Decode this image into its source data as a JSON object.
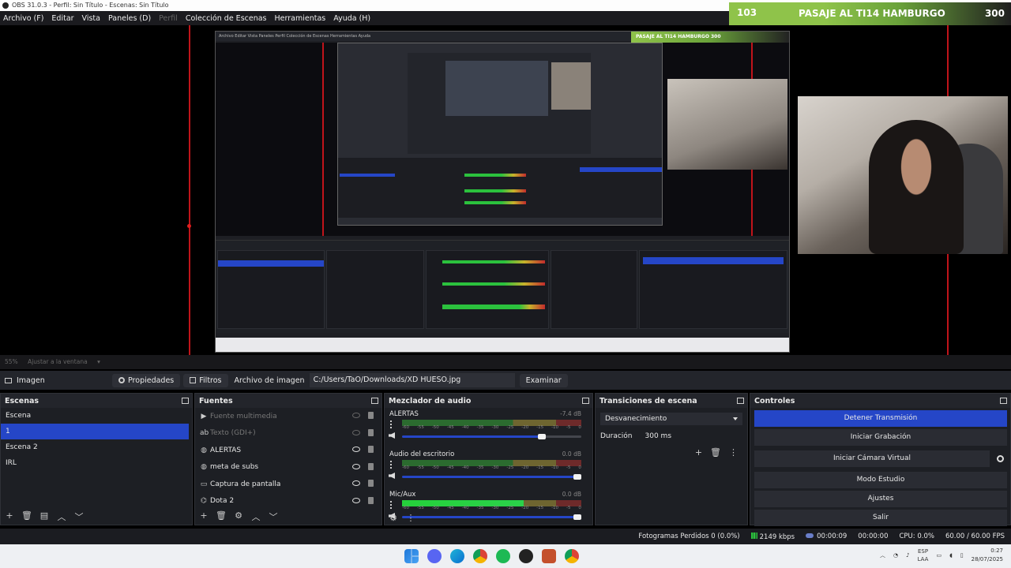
{
  "window": {
    "title": "OBS 31.0.3 - Perfil: Sin Título - Escenas: Sin Título"
  },
  "menu": [
    {
      "label": "Archivo (F)",
      "disabled": false
    },
    {
      "label": "Editar",
      "disabled": false
    },
    {
      "label": "Vista",
      "disabled": false
    },
    {
      "label": "Paneles (D)",
      "disabled": false
    },
    {
      "label": "Perfil",
      "disabled": true
    },
    {
      "label": "Colección de Escenas",
      "disabled": false
    },
    {
      "label": "Herramientas",
      "disabled": false
    },
    {
      "label": "Ayuda (H)",
      "disabled": false
    }
  ],
  "banner": {
    "left_number": "103",
    "text": "PASAJE AL TI14 HAMBURGO",
    "right_number": "300",
    "color": "#8fc34a"
  },
  "nested": {
    "menubar": "Archivo  Editar  Vista  Paneles  Perfil  Colección de Escenas  Herramientas  Ayuda",
    "banner": "PASAJE AL TI14 HAMBURGO  300"
  },
  "zoom": {
    "percent": "55%",
    "fit_label": "Ajustar a la ventana"
  },
  "context_bar": {
    "source_name": "Imagen",
    "properties_label": "Propiedades",
    "filters_label": "Filtros",
    "image_file_label": "Archivo de imagen",
    "image_path": "C:/Users/TaO/Downloads/XD HUESO.jpg",
    "browse_label": "Examinar"
  },
  "scenes": {
    "title": "Escenas",
    "items": [
      {
        "label": "Escena",
        "selected": false
      },
      {
        "label": "1",
        "selected": true
      },
      {
        "label": "Escena 2",
        "selected": false
      },
      {
        "label": "IRL",
        "selected": false
      }
    ]
  },
  "sources": {
    "title": "Fuentes",
    "items": [
      {
        "label": "Fuente multimedia",
        "icon": "play-icon",
        "visible": false
      },
      {
        "label": "Texto (GDI+)",
        "icon": "text-icon",
        "visible": false
      },
      {
        "label": "ALERTAS",
        "icon": "globe-icon",
        "visible": true
      },
      {
        "label": "meta de subs",
        "icon": "globe-icon",
        "visible": true
      },
      {
        "label": "Captura de pantalla",
        "icon": "monitor-icon",
        "visible": true
      },
      {
        "label": "Dota 2",
        "icon": "gamepad-icon",
        "visible": true
      }
    ]
  },
  "mixer": {
    "title": "Mezclador de audio",
    "ticks": [
      "-60",
      "-55",
      "-50",
      "-45",
      "-40",
      "-35",
      "-30",
      "-25",
      "-20",
      "-15",
      "-10",
      "-5",
      "0"
    ],
    "channels": [
      {
        "name": "ALERTAS",
        "db": "-7.4 dB",
        "level": 0.0,
        "volume": 0.8
      },
      {
        "name": "Audio del escritorio",
        "db": "0.0 dB",
        "level": 0.0,
        "volume": 1.0
      },
      {
        "name": "Mic/Aux",
        "db": "0.0 dB",
        "level": 0.68,
        "volume": 1.0
      }
    ]
  },
  "transitions": {
    "title": "Transiciones de escena",
    "selected": "Desvanecimiento",
    "duration_label": "Duración",
    "duration_value": "300 ms"
  },
  "controls": {
    "title": "Controles",
    "stop_stream": "Detener Transmisión",
    "start_recording": "Iniciar Grabación",
    "start_vcam": "Iniciar Cámara Virtual",
    "studio_mode": "Modo Estudio",
    "settings": "Ajustes",
    "exit": "Salir",
    "accent_color": "#2546c7"
  },
  "status": {
    "dropped_frames": "Fotogramas Perdidos 0 (0.0%)",
    "bitrate": "2149 kbps",
    "stream_time": "00:00:09",
    "recording_time": "00:00:00",
    "cpu": "CPU: 0.0%",
    "fps": "60.00 / 60.00 FPS"
  },
  "taskbar": {
    "lang_top": "ESP",
    "lang_bottom": "LAA",
    "time": "0:27",
    "date": "28/07/2025"
  }
}
